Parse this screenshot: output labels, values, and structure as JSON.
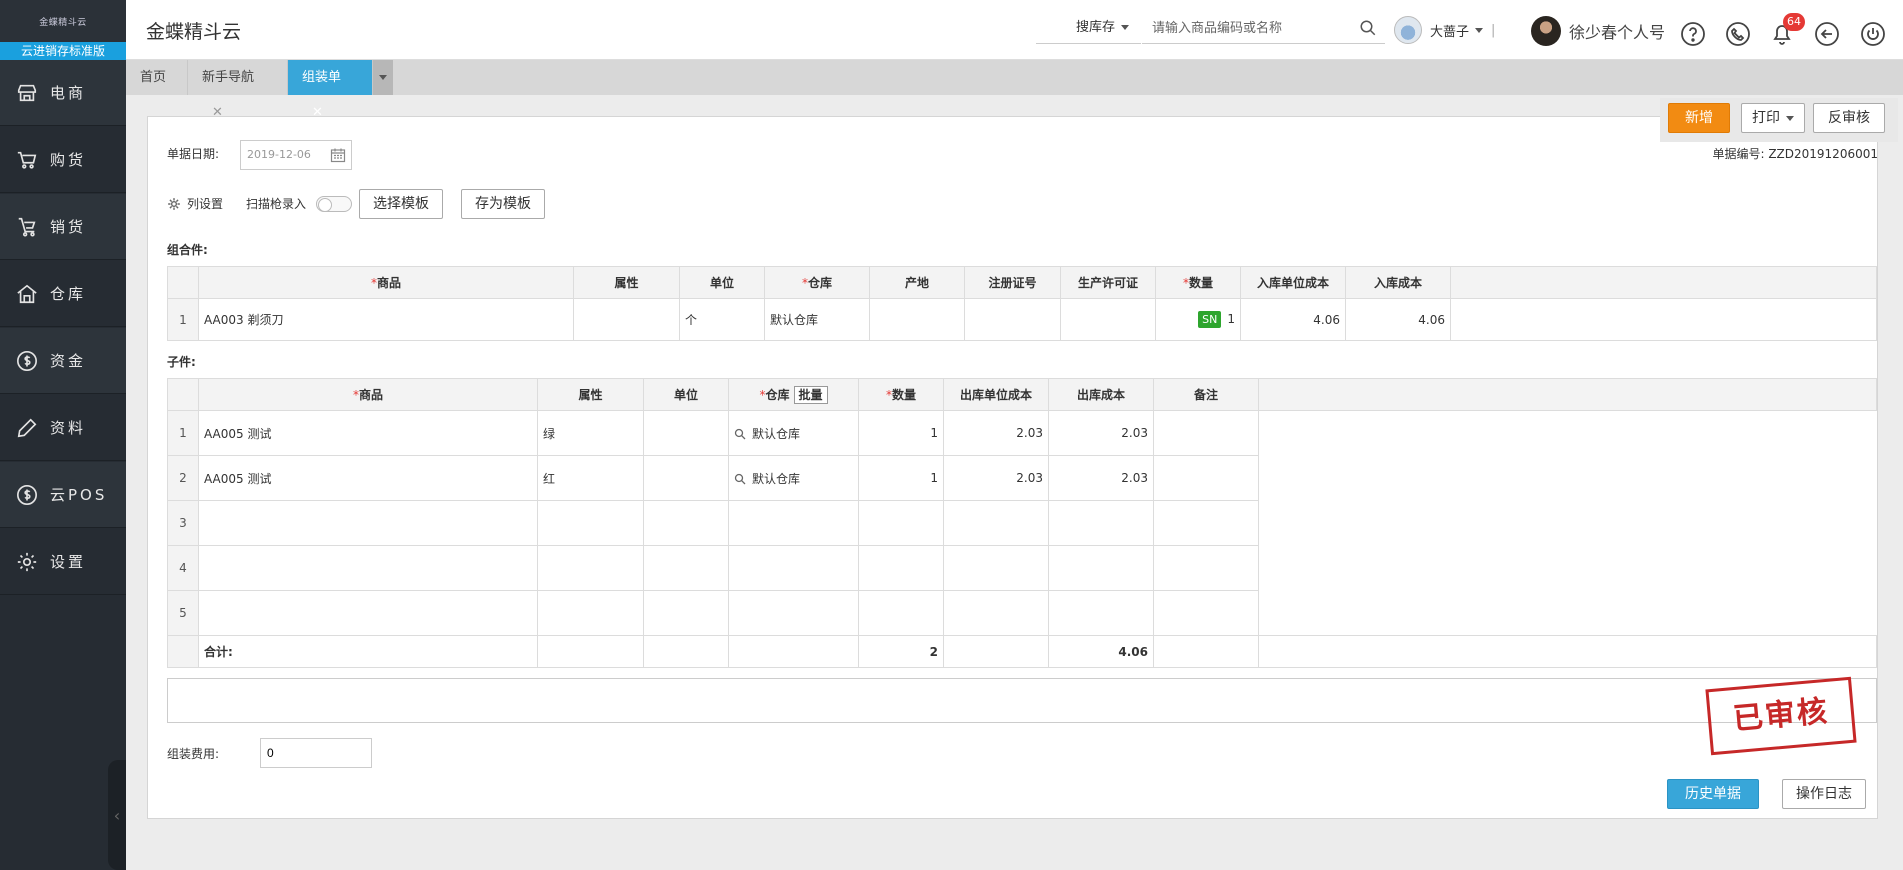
{
  "sidebar": {
    "brand_logo": "金蝶精斗云",
    "edition": "云进销存标准版",
    "items": [
      {
        "label": "电商",
        "icon": "store-icon"
      },
      {
        "label": "购货",
        "icon": "cart-icon"
      },
      {
        "label": "销货",
        "icon": "trolley-icon"
      },
      {
        "label": "仓库",
        "icon": "warehouse-icon"
      },
      {
        "label": "资金",
        "icon": "dollar-circle-icon"
      },
      {
        "label": "资料",
        "icon": "pen-icon"
      },
      {
        "label": "云POS",
        "icon": "pos-dollar-icon"
      },
      {
        "label": "设置",
        "icon": "gear-icon"
      }
    ]
  },
  "header": {
    "app_title": "金蝶精斗云",
    "store_select": "搜库存",
    "search_placeholder": "请输入商品编码或名称",
    "tenant_name": "大蔷子",
    "tenant_sep": "|",
    "user_name": "徐少春个人号",
    "notification_count": "64"
  },
  "tabs": [
    {
      "label": "首页",
      "active": false,
      "closable": false
    },
    {
      "label": "新手导航",
      "active": false,
      "closable": true
    },
    {
      "label": "组装单",
      "active": true,
      "closable": true
    }
  ],
  "close_glyph": "✕",
  "toolbar": {
    "new_label": "新增",
    "print_label": "打印",
    "unaudit_label": "反审核"
  },
  "form": {
    "date_label": "单据日期:",
    "date_value": "2019-12-06",
    "doc_no_label": "单据编号:",
    "doc_no": "ZZD20191206001",
    "column_settings": "列设置",
    "scan_label": "扫描枪录入",
    "choose_template": "选择模板",
    "save_template": "存为模板",
    "assembly_label": "组合件:",
    "sub_label": "子件:",
    "fee_label": "组装费用:",
    "fee_value": "0"
  },
  "assembly_table": {
    "headers": [
      "商品",
      "属性",
      "单位",
      "仓库",
      "产地",
      "注册证号",
      "生产许可证",
      "数量",
      "入库单位成本",
      "入库成本"
    ],
    "rows": [
      {
        "idx": "1",
        "product": "AA003 剃须刀",
        "attr": "",
        "unit": "个",
        "warehouse": "默认仓库",
        "origin": "",
        "reg_no": "",
        "license": "",
        "sn": "SN",
        "qty": "1",
        "unit_cost": "4.06",
        "cost": "4.06"
      }
    ]
  },
  "sub_table": {
    "headers": [
      "商品",
      "属性",
      "单位",
      "仓库",
      "数量",
      "出库单位成本",
      "出库成本",
      "备注"
    ],
    "batch_label": "批量",
    "rows": [
      {
        "idx": "1",
        "product": "AA005 测试",
        "attr": "绿",
        "unit": "",
        "warehouse": "默认仓库",
        "qty": "1",
        "unit_cost": "2.03",
        "cost": "2.03",
        "note": ""
      },
      {
        "idx": "2",
        "product": "AA005 测试",
        "attr": "红",
        "unit": "",
        "warehouse": "默认仓库",
        "qty": "1",
        "unit_cost": "2.03",
        "cost": "2.03",
        "note": ""
      },
      {
        "idx": "3",
        "product": "",
        "attr": "",
        "unit": "",
        "warehouse": "",
        "qty": "",
        "unit_cost": "",
        "cost": "",
        "note": ""
      },
      {
        "idx": "4",
        "product": "",
        "attr": "",
        "unit": "",
        "warehouse": "",
        "qty": "",
        "unit_cost": "",
        "cost": "",
        "note": ""
      },
      {
        "idx": "5",
        "product": "",
        "attr": "",
        "unit": "",
        "warehouse": "",
        "qty": "",
        "unit_cost": "",
        "cost": "",
        "note": ""
      }
    ],
    "total_label": "合计:",
    "total_qty": "2",
    "total_cost": "4.06"
  },
  "stamp": "已审核",
  "footer": {
    "history_label": "历史单据",
    "log_label": "操作日志"
  },
  "colors": {
    "accent_blue": "#38a6d9",
    "new_orange": "#f28b12",
    "sidebar_bg": "#262c33",
    "stamp_red": "#c62828",
    "sn_green": "#2ea52e"
  }
}
